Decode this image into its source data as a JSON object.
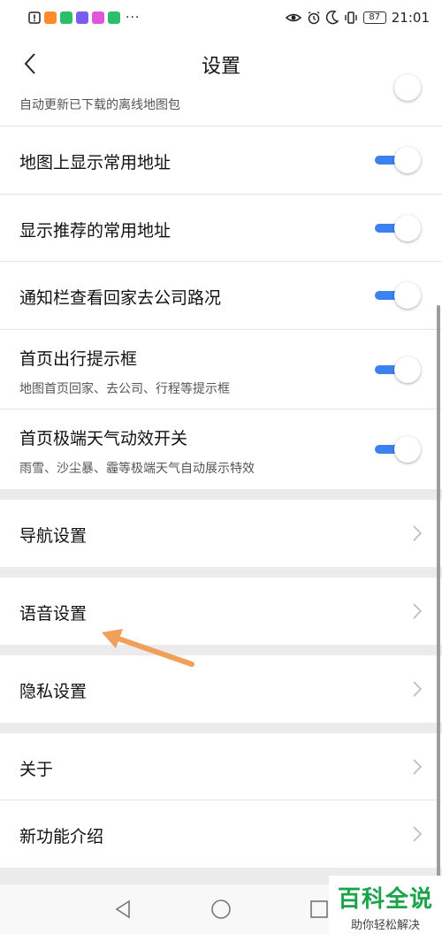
{
  "status_bar": {
    "time": "21:01",
    "battery": "87",
    "overflow": "···",
    "app_icon_colors": [
      "#ff8a2a",
      "#2bbf6b",
      "#7a5cf0",
      "#e056d8",
      "#2bbf6b"
    ]
  },
  "header": {
    "title": "设置"
  },
  "partial_row": {
    "subtitle": "自动更新已下载的离线地图包"
  },
  "toggle_rows": [
    {
      "label": "地图上显示常用地址",
      "on": true
    },
    {
      "label": "显示推荐的常用地址",
      "on": true
    },
    {
      "label": "通知栏查看回家去公司路况",
      "on": true
    },
    {
      "label": "首页出行提示框",
      "subtitle": "地图首页回家、去公司、行程等提示框",
      "on": true
    },
    {
      "label": "首页极端天气动效开关",
      "subtitle": "雨雪、沙尘暴、霾等极端天气自动展示特效",
      "on": true
    }
  ],
  "nav_rows": [
    {
      "label": "导航设置"
    },
    {
      "label": "语音设置"
    },
    {
      "label": "隐私设置"
    },
    {
      "label": "关于"
    },
    {
      "label": "新功能介绍"
    }
  ],
  "watermark": {
    "title": "百科全说",
    "subtitle": "助你轻松解决"
  },
  "colors": {
    "toggle_on": "#3b82f0",
    "arrow": "#f0a05a",
    "watermark_green": "#1aa34a"
  }
}
